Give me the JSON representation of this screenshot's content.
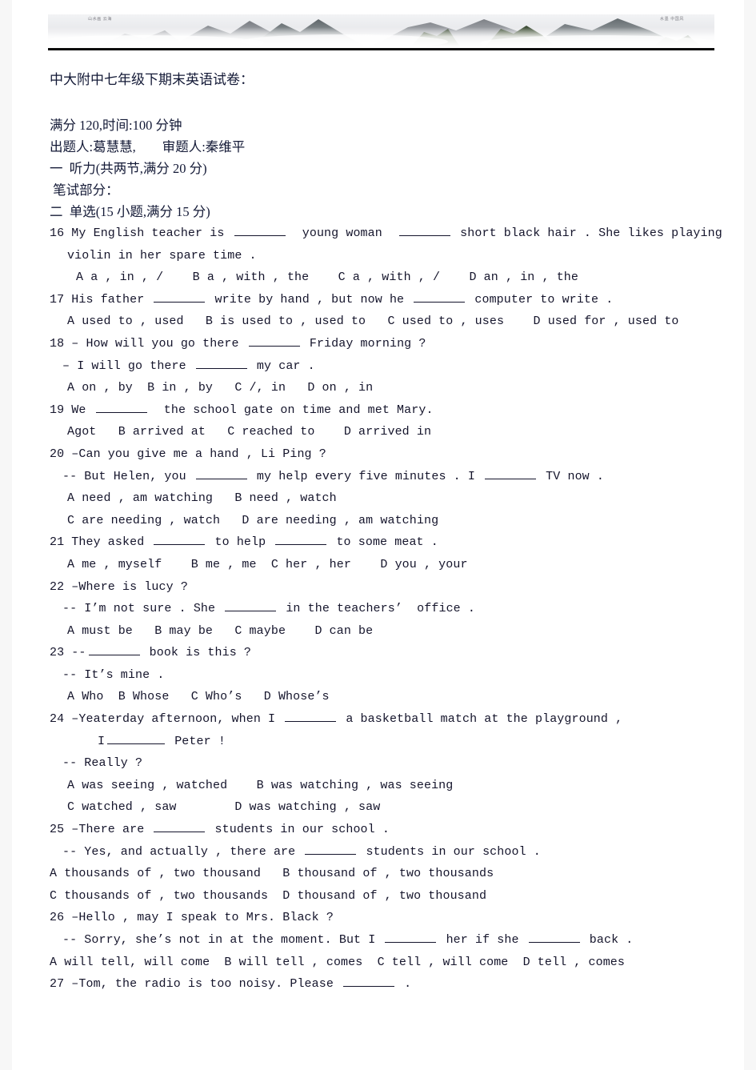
{
  "document": {
    "banner": {
      "caption_left": "山水画 云海",
      "caption_right": "水墨 中国风"
    },
    "title": "中大附中七年级下期末英语试卷：",
    "meta": {
      "score_time": "满分 120,时间:100 分钟",
      "authors": "出题人:葛慧慧,        审题人:秦维平"
    },
    "sections": [
      {
        "label": "一  听力(共两节,满分 20 分)"
      },
      {
        "label": " 笔试部分："
      },
      {
        "label": "二  单选(15 小题,满分 15 分)"
      }
    ],
    "questions": [
      {
        "number": "16",
        "lines": [
          {
            "indent": 0,
            "parts": [
              {
                "t": "text",
                "v": "16 My English teacher is "
              },
              {
                "t": "blank",
                "w": "b-md"
              },
              {
                "t": "text",
                "v": "  young woman  "
              },
              {
                "t": "blank",
                "w": "b-md"
              },
              {
                "t": "text",
                "v": " short black hair . She likes playing"
              }
            ]
          },
          {
            "indent": 2,
            "parts": [
              {
                "t": "text",
                "v": "violin in her spare time ."
              }
            ]
          },
          {
            "indent": 3,
            "parts": [
              {
                "t": "text",
                "v": "A a , in , /    B a , with , the    C a , with , /    D an , in , the"
              }
            ]
          }
        ]
      },
      {
        "number": "17",
        "lines": [
          {
            "indent": 0,
            "parts": [
              {
                "t": "text",
                "v": "17 His father "
              },
              {
                "t": "blank",
                "w": "b-md"
              },
              {
                "t": "text",
                "v": " write by hand , but now he "
              },
              {
                "t": "blank",
                "w": "b-md"
              },
              {
                "t": "text",
                "v": " computer to write ."
              }
            ]
          },
          {
            "indent": 2,
            "parts": [
              {
                "t": "text",
                "v": "A used to , used   B is used to , used to   C used to , uses    D used for , used to"
              }
            ]
          }
        ]
      },
      {
        "number": "18",
        "lines": [
          {
            "indent": 0,
            "parts": [
              {
                "t": "text",
                "v": "18 – How will you go there "
              },
              {
                "t": "blank",
                "w": "b-md"
              },
              {
                "t": "text",
                "v": " Friday morning ?"
              }
            ]
          },
          {
            "indent": 1,
            "parts": [
              {
                "t": "text",
                "v": "– I will go there "
              },
              {
                "t": "blank",
                "w": "b-md"
              },
              {
                "t": "text",
                "v": " my car ."
              }
            ]
          },
          {
            "indent": 2,
            "parts": [
              {
                "t": "text",
                "v": "A on , by  B in , by   C /, in   D on , in"
              }
            ]
          }
        ]
      },
      {
        "number": "19",
        "lines": [
          {
            "indent": 0,
            "parts": [
              {
                "t": "text",
                "v": "19 We "
              },
              {
                "t": "blank",
                "w": "b-md"
              },
              {
                "t": "text",
                "v": "  the school gate on time and met Mary."
              }
            ]
          },
          {
            "indent": 2,
            "parts": [
              {
                "t": "text",
                "v": "Agot   B arrived at   C reached to    D arrived in"
              }
            ]
          }
        ]
      },
      {
        "number": "20",
        "lines": [
          {
            "indent": 0,
            "parts": [
              {
                "t": "text",
                "v": "20 –Can you give me a hand , Li Ping ?"
              }
            ]
          },
          {
            "indent": 1,
            "parts": [
              {
                "t": "text",
                "v": "-- But Helen, you "
              },
              {
                "t": "blank",
                "w": "b-md"
              },
              {
                "t": "text",
                "v": " my help every five minutes . I "
              },
              {
                "t": "blank",
                "w": "b-md"
              },
              {
                "t": "text",
                "v": " TV now ."
              }
            ]
          },
          {
            "indent": 2,
            "parts": [
              {
                "t": "text",
                "v": "A need , am watching   B need , watch"
              }
            ]
          },
          {
            "indent": 2,
            "parts": [
              {
                "t": "text",
                "v": "C are needing , watch   D are needing , am watching"
              }
            ]
          }
        ]
      },
      {
        "number": "21",
        "lines": [
          {
            "indent": 0,
            "parts": [
              {
                "t": "text",
                "v": "21 They asked "
              },
              {
                "t": "blank",
                "w": "b-md"
              },
              {
                "t": "text",
                "v": " to help "
              },
              {
                "t": "blank",
                "w": "b-md"
              },
              {
                "t": "text",
                "v": " to some meat ."
              }
            ]
          },
          {
            "indent": 2,
            "parts": [
              {
                "t": "text",
                "v": "A me , myself    B me , me  C her , her    D you , your"
              }
            ]
          }
        ]
      },
      {
        "number": "22",
        "lines": [
          {
            "indent": 0,
            "parts": [
              {
                "t": "text",
                "v": "22 –Where is lucy ?"
              }
            ]
          },
          {
            "indent": 1,
            "parts": [
              {
                "t": "text",
                "v": "-- I’m not sure . She "
              },
              {
                "t": "blank",
                "w": "b-md"
              },
              {
                "t": "text",
                "v": " in the teachers’  office ."
              }
            ]
          },
          {
            "indent": 2,
            "parts": [
              {
                "t": "text",
                "v": "A must be   B may be   C maybe    D can be"
              }
            ]
          }
        ]
      },
      {
        "number": "23",
        "lines": [
          {
            "indent": 0,
            "parts": [
              {
                "t": "text",
                "v": "23 --"
              },
              {
                "t": "blank",
                "w": "b-md"
              },
              {
                "t": "text",
                "v": " book is this ?"
              }
            ]
          },
          {
            "indent": 1,
            "parts": [
              {
                "t": "text",
                "v": "-- It’s mine ."
              }
            ]
          },
          {
            "indent": 2,
            "parts": [
              {
                "t": "text",
                "v": "A Who  B Whose   C Who’s   D Whose’s"
              }
            ]
          }
        ]
      },
      {
        "number": "24",
        "lines": [
          {
            "indent": 0,
            "parts": [
              {
                "t": "text",
                "v": "24 –Yeaterday afternoon, when I "
              },
              {
                "t": "blank",
                "w": "b-md"
              },
              {
                "t": "text",
                "v": " a basketball match at the playground ,"
              }
            ]
          },
          {
            "indent": 4,
            "parts": [
              {
                "t": "text",
                "v": "I"
              },
              {
                "t": "blank",
                "w": "b-lg"
              },
              {
                "t": "text",
                "v": " Peter !"
              }
            ]
          },
          {
            "indent": 1,
            "parts": [
              {
                "t": "text",
                "v": "-- Really ?"
              }
            ]
          },
          {
            "indent": 2,
            "parts": [
              {
                "t": "text",
                "v": "A was seeing , watched    B was watching , was seeing"
              }
            ]
          },
          {
            "indent": 2,
            "parts": [
              {
                "t": "text",
                "v": "C watched , saw        D was watching , saw"
              }
            ]
          }
        ]
      },
      {
        "number": "25",
        "lines": [
          {
            "indent": 0,
            "parts": [
              {
                "t": "text",
                "v": "25 –There are "
              },
              {
                "t": "blank",
                "w": "b-md"
              },
              {
                "t": "text",
                "v": " students in our school ."
              }
            ]
          },
          {
            "indent": 1,
            "parts": [
              {
                "t": "text",
                "v": "-- Yes, and actually , there are "
              },
              {
                "t": "blank",
                "w": "b-md"
              },
              {
                "t": "text",
                "v": " students in our school ."
              }
            ]
          },
          {
            "indent": -1,
            "parts": [
              {
                "t": "text",
                "v": "A thousands of , two thousand   B thousand of , two thousands"
              }
            ]
          },
          {
            "indent": -1,
            "parts": [
              {
                "t": "text",
                "v": "C thousands of , two thousands  D thousand of , two thousand"
              }
            ]
          }
        ]
      },
      {
        "number": "26",
        "lines": [
          {
            "indent": 0,
            "parts": [
              {
                "t": "text",
                "v": "26 –Hello , may I speak to Mrs. Black ?"
              }
            ]
          },
          {
            "indent": 1,
            "parts": [
              {
                "t": "text",
                "v": "-- Sorry, she’s not in at the moment. But I "
              },
              {
                "t": "blank",
                "w": "b-md"
              },
              {
                "t": "text",
                "v": " her if she "
              },
              {
                "t": "blank",
                "w": "b-md"
              },
              {
                "t": "text",
                "v": " back ."
              }
            ]
          },
          {
            "indent": -1,
            "parts": [
              {
                "t": "text",
                "v": "A will tell, will come  B will tell , comes  C tell , will come  D tell , comes"
              }
            ]
          }
        ]
      },
      {
        "number": "27",
        "lines": [
          {
            "indent": 0,
            "parts": [
              {
                "t": "text",
                "v": "27 –Tom, the radio is too noisy. Please "
              },
              {
                "t": "blank",
                "w": "b-md"
              },
              {
                "t": "text",
                "v": " ."
              }
            ]
          }
        ]
      }
    ]
  }
}
